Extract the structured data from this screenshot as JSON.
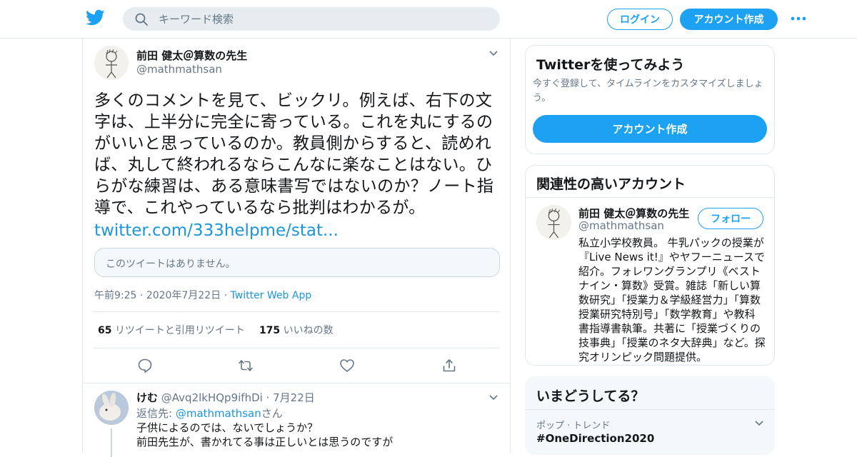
{
  "colors": {
    "accent": "#1da1f2",
    "link": "#1b95e0",
    "text": "#14171a",
    "muted": "#657786",
    "border": "#e1e8ed"
  },
  "header": {
    "logo_icon": "twitter-bird-icon",
    "search_placeholder": "キーワード検索",
    "login_label": "ログイン",
    "signup_label": "アカウント作成",
    "more_icon": "more-dots-icon"
  },
  "tweet": {
    "author_name": "前田 健太＠算数の先生",
    "author_handle": "@mathmathsan",
    "text": "多くのコメントを見て、ビックリ。例えば、右下の文字は、上半分に完全に寄っている。これを丸にするのがいいと思っているのか。教員側からすると、読めれば、丸して終われるならこんなに楽なことはない。ひらがな練習は、ある意味書写ではないのか？ノート指導で、これやっているなら批判はわかるが。",
    "link": "twitter.com/333helpme/stat...",
    "unavailable_quote": "このツイートはありません。",
    "time": "午前9:25",
    "date": "2020年7月22日",
    "app": "Twitter Web App",
    "retweet_count": "65",
    "retweet_label": "リツイートと引用リツイート",
    "like_count": "175",
    "like_label": "いいねの数"
  },
  "reply": {
    "name": "けむ",
    "handle": "@Avq2lkHQp9ifhDi",
    "date": "7月22日",
    "reply_to_label": "返信先:",
    "reply_to_handle": "@mathmathsan",
    "reply_to_suffix": "さん",
    "line1": "子供によるのでは、ないでしょうか？",
    "line2": "前田先生が、書かれてる事は正しいとは思うのですが"
  },
  "sidebar": {
    "try": {
      "title": "Twitterを使ってみよう",
      "desc": "今すぐ登録して、タイムラインをカスタマイズしましょう。",
      "cta": "アカウント作成"
    },
    "related": {
      "title": "関連性の高いアカウント",
      "name": "前田 健太＠算数の先生",
      "handle": "@mathmathsan",
      "follow_label": "フォロー",
      "bio": "私立小学校教員。 牛乳パックの授業が『Live News it!』やヤフーニュースで紹介。フォレワングランプリ《ベストナイン・算数》受賞。雑誌「新しい算数研究」「授業力＆学級経営力」「算数授業研究特別号」「数学教育」や教科書指導書執筆。共著に「授業づくりの技事典」「授業のネタ大辞典」など。探究オリンピック問題提供。"
    },
    "trends": {
      "title": "いまどうしてる？",
      "context": "ポップ · トレンド",
      "name": "#OneDirection2020"
    }
  }
}
